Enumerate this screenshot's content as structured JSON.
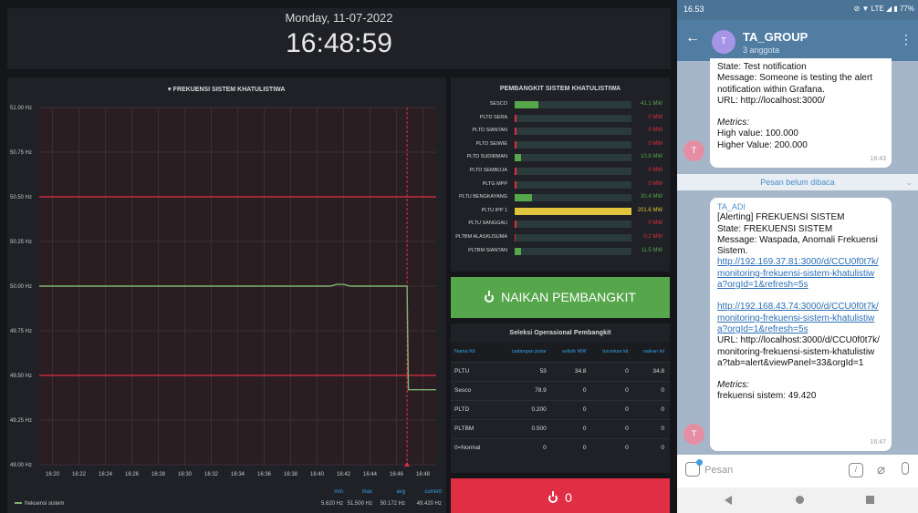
{
  "dashboard": {
    "date": "Monday, 11-07-2022",
    "time": "16:48:59",
    "graph": {
      "title": "FREKUENSI SISTEM KHATULISTIWA",
      "y_ticks": [
        "51.00 Hz",
        "50.75 Hz",
        "50.50 Hz",
        "50.25 Hz",
        "50.00 Hz",
        "49.75 Hz",
        "49.50 Hz",
        "49.25 Hz",
        "49.00 Hz"
      ],
      "x_ticks": [
        "16:20",
        "16:22",
        "16:24",
        "16:26",
        "16:28",
        "16:30",
        "16:32",
        "16:34",
        "16:36",
        "16:38",
        "16:40",
        "16:42",
        "16:44",
        "16:46",
        "16:48"
      ],
      "legend": "frekuensi sistem",
      "stats_headers": {
        "min": "min",
        "max": "max",
        "avg": "avg",
        "current": "current"
      },
      "stats_values": {
        "min": "5.620 Hz",
        "max": "51.500 Hz",
        "avg": "50.172 Hz",
        "current": "49.420 Hz"
      },
      "colors": {
        "line": "#7eb26d",
        "threshold": "#e02f44",
        "fill": "#2a1e22"
      }
    },
    "gauge": {
      "title": "PEMBANGKIT SISTEM KHATULISTIWA",
      "max": 201.6,
      "items": [
        {
          "label": "SESCO",
          "value": 41.1,
          "text": "41.1 MW",
          "color": "#56a64b"
        },
        {
          "label": "PLTD SERA",
          "value": 0,
          "text": "0 MW",
          "color": "#e02f44"
        },
        {
          "label": "PLTD SIANTAN",
          "value": 0,
          "text": "0 MW",
          "color": "#e02f44"
        },
        {
          "label": "PLTD SEIWIE",
          "value": 0,
          "text": "0 MW",
          "color": "#e02f44"
        },
        {
          "label": "PLTD SUDIRMAN",
          "value": 10.8,
          "text": "10.8 MW",
          "color": "#56a64b"
        },
        {
          "label": "PLTD SEMBOJA",
          "value": 0,
          "text": "0 MW",
          "color": "#e02f44"
        },
        {
          "label": "PLTG MPP",
          "value": 0,
          "text": "0 MW",
          "color": "#e02f44"
        },
        {
          "label": "PLTU BENGKAYANG",
          "value": 30.4,
          "text": "30.4 MW",
          "color": "#56a64b"
        },
        {
          "label": "PLTU IPP 1",
          "value": 201.6,
          "text": "201.6 MW",
          "color": "#e0c43c"
        },
        {
          "label": "PLTU SANGGAU",
          "value": 0,
          "text": "0 MW",
          "color": "#e02f44"
        },
        {
          "label": "PLTBM ALASKUSUMA",
          "value": 0.2,
          "text": "0.2 MW",
          "color": "#e02f44"
        },
        {
          "label": "PLTBM SIANTAN",
          "value": 11.5,
          "text": "11.5 MW",
          "color": "#56a64b"
        }
      ]
    },
    "naikan_button": "NAIKAN PEMBANGKIT",
    "table": {
      "title": "Seleksi Operasional Pembangkit",
      "headers": [
        "Nama Kit",
        "cadangan putar",
        "selisih MW",
        "turunkan kit",
        "naikan kit"
      ],
      "rows": [
        [
          "PLTU",
          "53",
          "34.8",
          "0",
          "34.8"
        ],
        [
          "Sesco",
          "78.9",
          "0",
          "0",
          "0"
        ],
        [
          "PLTD",
          "0.200",
          "0",
          "0",
          "0"
        ],
        [
          "PLTBM",
          "0.500",
          "0",
          "0",
          "0"
        ],
        [
          "0=Normal",
          "0",
          "0",
          "0",
          "0"
        ]
      ]
    },
    "power_value": "0"
  },
  "telegram": {
    "status_time": "16.53",
    "status_icons": "⊘ ▼ LTE ◢ ▮ 77%",
    "chat_name": "TA_GROUP",
    "members": "3 anggota",
    "avatar_letter": "T",
    "msg1": {
      "lines": [
        "State: Test notification",
        "Message: Someone is testing the alert notification within Grafana.",
        "URL: http://localhost:3000/"
      ],
      "metrics_label": "Metrics:",
      "metrics": [
        "High value: 100.000",
        "Higher Value: 200.000"
      ],
      "time": "16:43"
    },
    "unread": "Pesan belum dibaca",
    "msg2": {
      "sender": "TA_ADI",
      "title": "[Alerting] FREKUENSI SISTEM",
      "state": "State: FREKUENSI SISTEM",
      "message": "Message: Waspada, Anomali Frekuensi Sistem.",
      "link1": "http://192.169.37.81:3000/d/CCU0f0t7k/monitoring-frekuensi-sistem-khatulistiwa?orgId=1&refresh=5s",
      "link2": "http://192.168.43.74:3000/d/CCU0f0t7k/monitoring-frekuensi-sistem-khatulistiwa?orgId=1&refresh=5s",
      "url": "URL: http://localhost:3000/d/CCU0f0t7k/monitoring-frekuensi-sistem-khatulistiwa?tab=alert&viewPanel=33&orgId=1",
      "metrics_label": "Metrics:",
      "metrics": "frekuensi sistem: 49.420",
      "time": "16:47"
    },
    "input_placeholder": "Pesan"
  },
  "chart_data": {
    "type": "line",
    "title": "FREKUENSI SISTEM KHATULISTIWA",
    "xlabel": "",
    "ylabel": "",
    "ylim": [
      49.0,
      51.0
    ],
    "xlim": [
      "16:19",
      "16:49"
    ],
    "thresholds": [
      50.5,
      49.5
    ],
    "series": [
      {
        "name": "frekuensi sistem",
        "x": [
          "16:19",
          "16:40",
          "16:41",
          "16:41.5",
          "16:42",
          "16:42.5",
          "16:43",
          "16:46.8",
          "16:46.9",
          "16:49"
        ],
        "y": [
          50.0,
          50.0,
          50.0,
          50.01,
          50.01,
          50.0,
          50.0,
          50.0,
          49.42,
          49.42
        ]
      }
    ],
    "legend": "bottom-left",
    "grid": true
  }
}
